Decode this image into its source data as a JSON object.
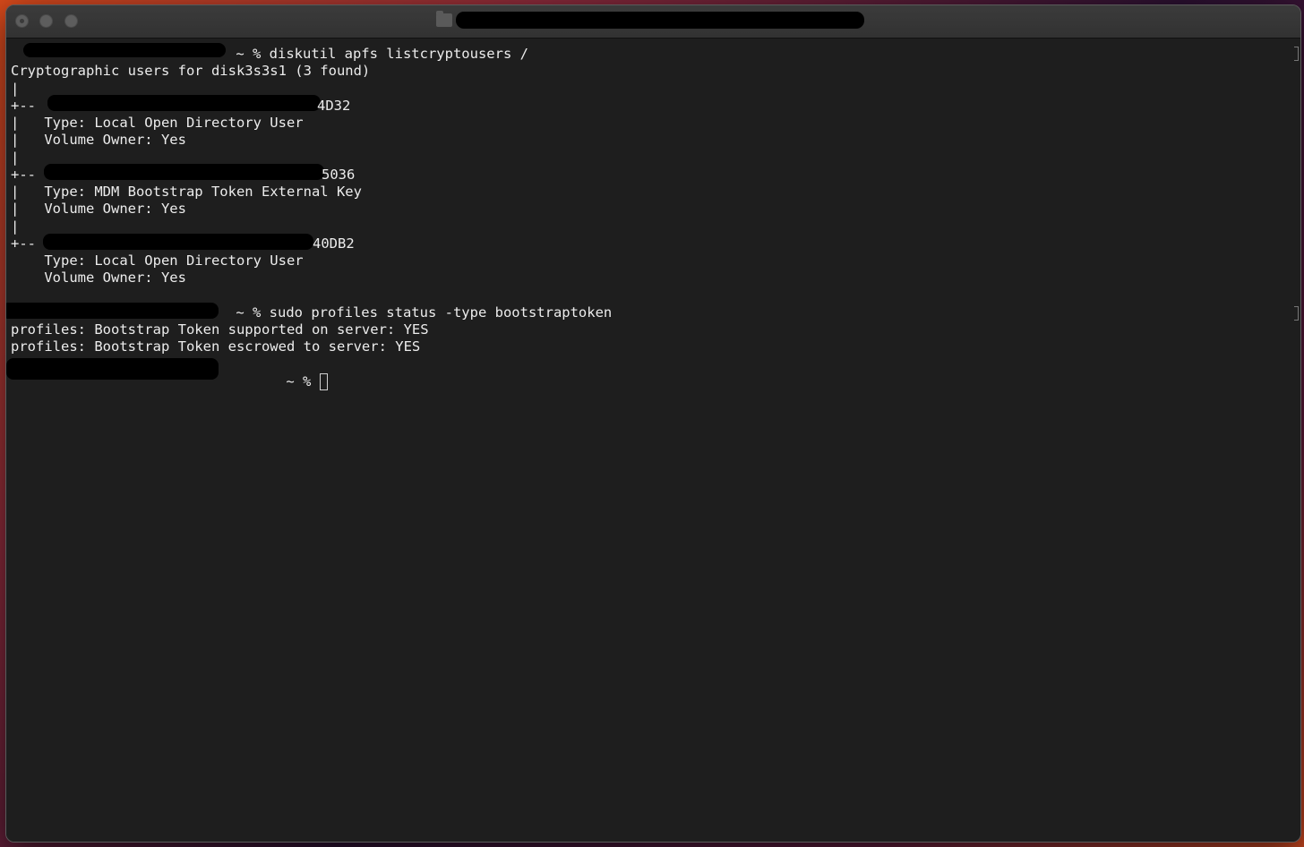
{
  "window": {
    "title": ""
  },
  "terminal": {
    "lines": [
      " ~ % diskutil apfs listcryptousers /",
      "Cryptographic users for disk3s3s1 (3 found)",
      "|",
      "+--",
      "4D32",
      "|   Type: Local Open Directory User",
      "|   Volume Owner: Yes",
      "|",
      "+--",
      "5036",
      "|   Type: MDM Bootstrap Token External Key",
      "|   Volume Owner: Yes",
      "|",
      "+--",
      "40DB2",
      "    Type: Local Open Directory User",
      "    Volume Owner: Yes",
      " ~ % sudo profiles status -type bootstraptoken",
      "profiles: Bootstrap Token supported on server: YES",
      "profiles: Bootstrap Token escrowed to server: YES",
      " ~ % "
    ]
  }
}
